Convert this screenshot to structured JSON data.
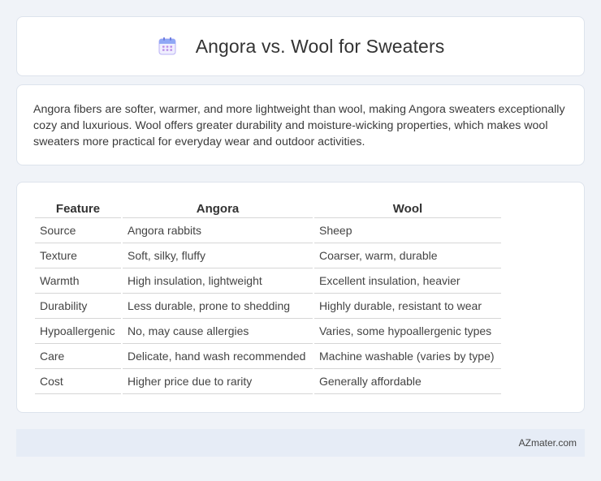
{
  "header": {
    "title": "Angora vs. Wool for Sweaters",
    "icon": "calendar-icon",
    "icon_color": "#8b7cf0"
  },
  "summary": {
    "text": "Angora fibers are softer, warmer, and more lightweight than wool, making Angora sweaters exceptionally cozy and luxurious. Wool offers greater durability and moisture-wicking properties, which makes wool sweaters more practical for everyday wear and outdoor activities."
  },
  "table": {
    "headers": [
      "Feature",
      "Angora",
      "Wool"
    ],
    "rows": [
      [
        "Source",
        "Angora rabbits",
        "Sheep"
      ],
      [
        "Texture",
        "Soft, silky, fluffy",
        "Coarser, warm, durable"
      ],
      [
        "Warmth",
        "High insulation, lightweight",
        "Excellent insulation, heavier"
      ],
      [
        "Durability",
        "Less durable, prone to shedding",
        "Highly durable, resistant to wear"
      ],
      [
        "Hypoallergenic",
        "No, may cause allergies",
        "Varies, some hypoallergenic types"
      ],
      [
        "Care",
        "Delicate, hand wash recommended",
        "Machine washable (varies by type)"
      ],
      [
        "Cost",
        "Higher price due to rarity",
        "Generally affordable"
      ]
    ]
  },
  "footer": {
    "brand": "AZmater.com"
  }
}
